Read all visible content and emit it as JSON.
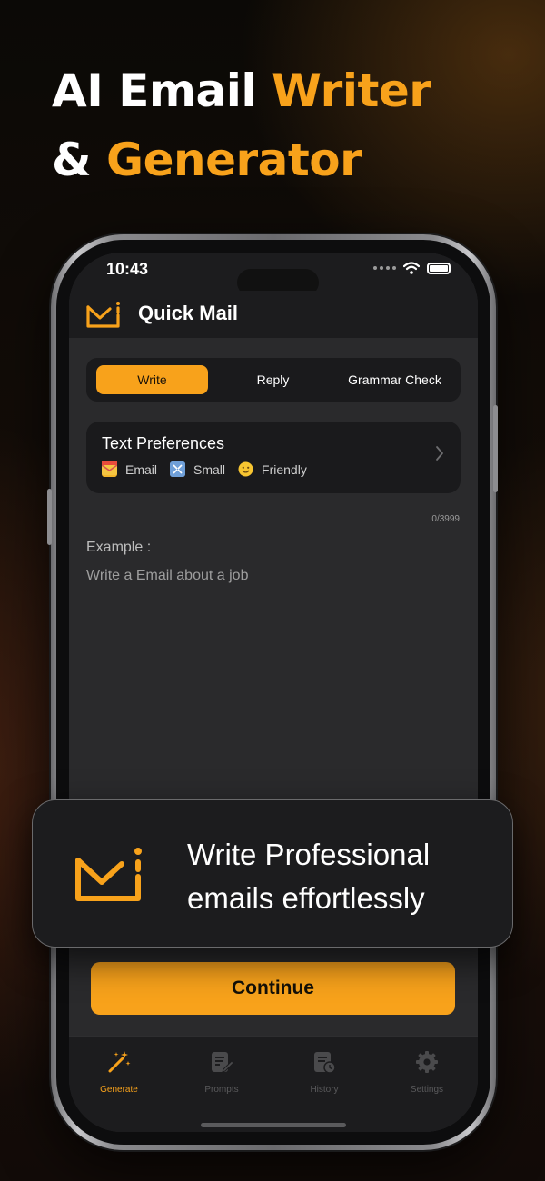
{
  "headline": {
    "line1_white": "AI Email",
    "line1_orange": "Writer",
    "line2_white": "&",
    "line2_orange": "Generator"
  },
  "status_bar": {
    "time": "10:43"
  },
  "app": {
    "title": "Quick Mail",
    "logo_icon": "mail-logo-icon"
  },
  "tabs": [
    {
      "label": "Write",
      "active": true
    },
    {
      "label": "Reply",
      "active": false
    },
    {
      "label": "Grammar Check",
      "active": false
    }
  ],
  "text_preferences": {
    "title": "Text Preferences",
    "options": [
      {
        "icon": "envelope-emoji-icon",
        "label": "Email"
      },
      {
        "icon": "arrows-emoji-icon",
        "label": "Small"
      },
      {
        "icon": "smiley-emoji-icon",
        "label": "Friendly"
      }
    ]
  },
  "editor": {
    "counter": "0/3999",
    "example_label": "Example :",
    "example_text": "Write a Email about a job"
  },
  "promo": {
    "line1": "Write Professional",
    "line2": "emails effortlessly"
  },
  "continue_label": "Continue",
  "bottom_nav": [
    {
      "label": "Generate",
      "icon": "magic-wand-icon",
      "active": true
    },
    {
      "label": "Prompts",
      "icon": "prompts-icon",
      "active": false
    },
    {
      "label": "History",
      "icon": "history-icon",
      "active": false
    },
    {
      "label": "Settings",
      "icon": "gear-icon",
      "active": false
    }
  ],
  "colors": {
    "accent": "#f8a21b",
    "background": "#2a2a2c",
    "card": "#1a1a1c"
  }
}
